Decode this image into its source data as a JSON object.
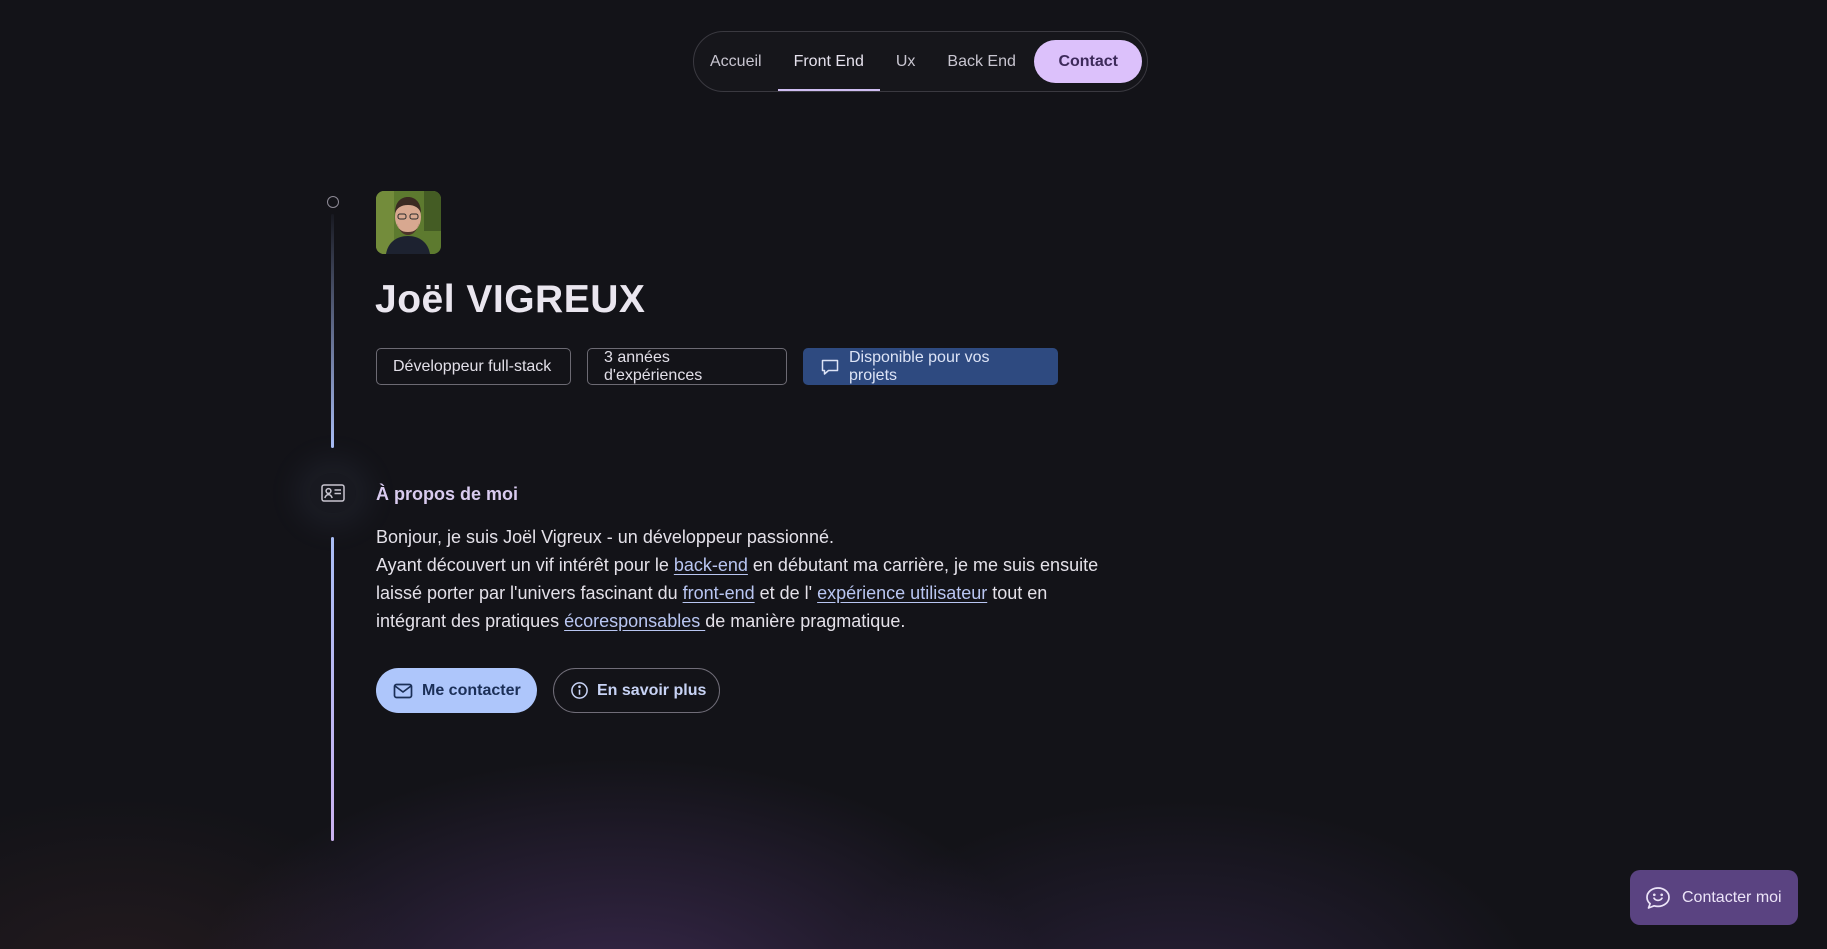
{
  "nav": {
    "items": [
      {
        "label": "Accueil"
      },
      {
        "label": "Front End",
        "active": true
      },
      {
        "label": "Ux"
      },
      {
        "label": "Back End"
      }
    ],
    "contact_label": "Contact"
  },
  "profile": {
    "name": "Joël VIGREUX",
    "chips": {
      "role": "Développeur full-stack",
      "experience": "3 années d'expériences",
      "availability": "Disponible pour vos projets"
    }
  },
  "about": {
    "title": "À propos de moi",
    "line1": "Bonjour, je suis Joël Vigreux - un développeur passionné.",
    "line2_a": "Ayant découvert un vif intérêt pour le ",
    "line2_link": "back-end",
    "line2_b": " en débutant ma carrière, je me suis ensuite",
    "line3_a": "laissé porter par l'univers fascinant du ",
    "line3_link1": "front-end",
    "line3_b": " et de l' ",
    "line3_link2": "expérience utilisateur",
    "line3_c": " tout en",
    "line4_a": "intégrant des pratiques ",
    "line4_link": "écoresponsables ",
    "line4_b": "de manière pragmatique."
  },
  "actions": {
    "contact_label": "Me contacter",
    "more_label": "En savoir plus"
  },
  "fab": {
    "label": "Contacter moi"
  },
  "colors": {
    "background": "#131318",
    "nav_contact_bg": "#dcc1fb",
    "availability_chip": "#2e4a80",
    "primary_button": "#aec6fb",
    "fab_bg": "#5a4381"
  },
  "icons": [
    "chat-bubble-icon",
    "id-card-icon",
    "mail-icon",
    "info-icon",
    "chat-smile-icon"
  ]
}
